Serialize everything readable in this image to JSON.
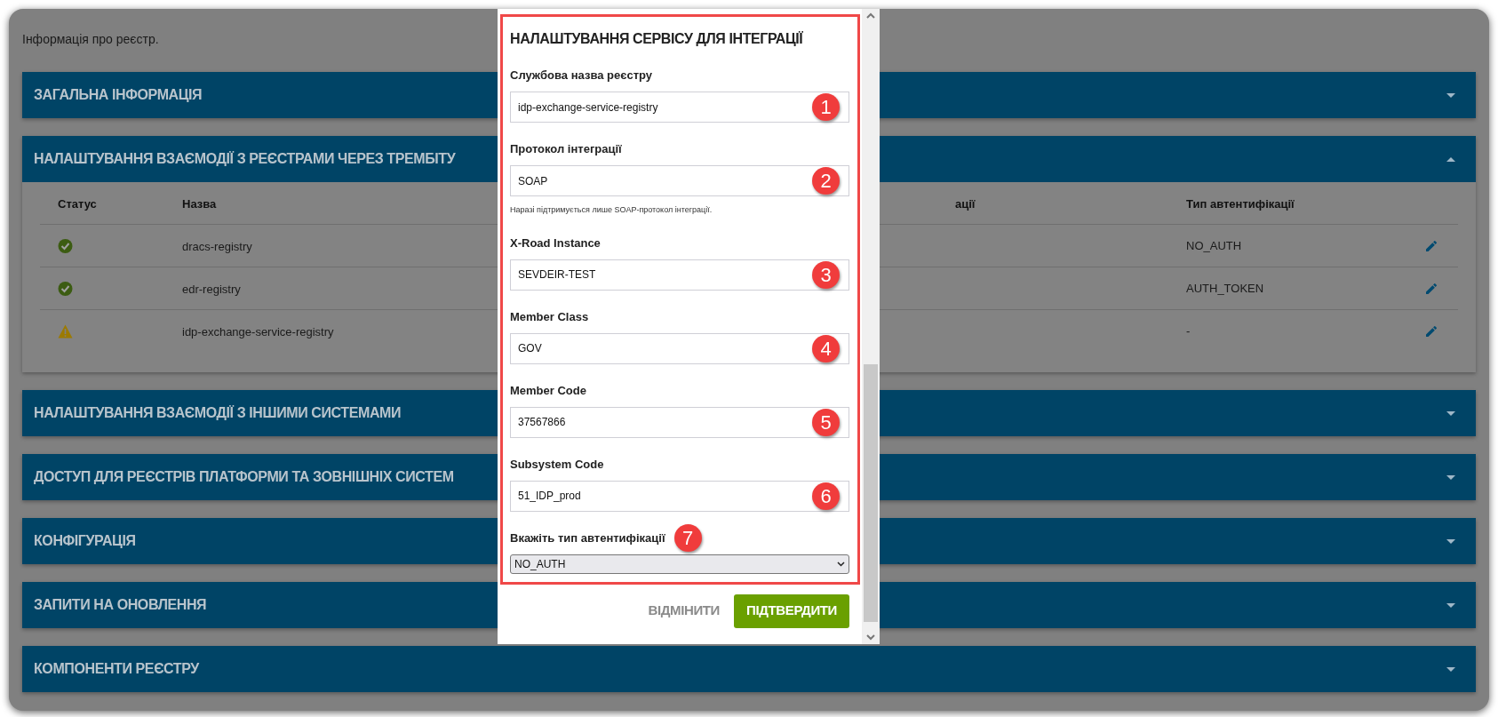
{
  "intro": "Інформація про реєстр.",
  "sections": [
    {
      "title": "ЗАГАЛЬНА ІНФОРМАЦІЯ",
      "expanded": false
    },
    {
      "title": "НАЛАШТУВАННЯ ВЗАЄМОДІЇ З РЕЄСТРАМИ ЧЕРЕЗ ТРЕМБІТУ",
      "expanded": true,
      "table": {
        "columns": [
          "Статус",
          "Назва",
          "ації",
          "Тип автентифікації"
        ],
        "rows": [
          {
            "kind": "ok",
            "name": "dracs-registry",
            "auth": "NO_AUTH"
          },
          {
            "kind": "ok",
            "name": "edr-registry",
            "auth": "AUTH_TOKEN"
          },
          {
            "kind": "warning",
            "name": "idp-exchange-service-registry",
            "auth": "-"
          }
        ]
      }
    },
    {
      "title": "НАЛАШТУВАННЯ ВЗАЄМОДІЇ З ІНШИМИ СИСТЕМАМИ",
      "expanded": false
    },
    {
      "title": "ДОСТУП ДЛЯ РЕЄСТРІВ ПЛАТФОРМИ ТА ЗОВНІШНІХ СИСТЕМ",
      "expanded": false
    },
    {
      "title": "КОНФІГУРАЦІЯ",
      "expanded": false
    },
    {
      "title": "ЗАПИТИ НА ОНОВЛЕННЯ",
      "expanded": false
    },
    {
      "title": "КОМПОНЕНТИ РЕЄСТРУ",
      "expanded": false
    }
  ],
  "dialog": {
    "title": "НАЛАШТУВАННЯ СЕРВІСУ ДЛЯ ІНТЕГРАЦІЇ",
    "fields": [
      {
        "kind": "text",
        "label": "Службова назва реєстру",
        "value": "idp-exchange-service-registry",
        "marker": "1"
      },
      {
        "kind": "text",
        "label": "Протокол інтеграції",
        "value": "SOAP",
        "marker": "2",
        "hint": "Наразі підтримується лише SOAP-протокол інтеграції."
      },
      {
        "kind": "text",
        "label": "X-Road Instance",
        "value": "SEVDEIR-TEST",
        "marker": "3"
      },
      {
        "kind": "text",
        "label": "Member Class",
        "value": "GOV",
        "marker": "4"
      },
      {
        "kind": "text",
        "label": "Member Code",
        "value": "37567866",
        "marker": "5"
      },
      {
        "kind": "text",
        "label": "Subsystem Code",
        "value": "51_IDP_prod",
        "marker": "6"
      },
      {
        "kind": "select",
        "label": "Вкажіть тип автентифікації",
        "value": "NO_AUTH",
        "marker": "7"
      }
    ],
    "buttons": [
      {
        "kind": "secondary",
        "label": "ВІДМІНИТИ"
      },
      {
        "kind": "primary",
        "label": "ПІДТВЕРДИТИ"
      }
    ]
  }
}
